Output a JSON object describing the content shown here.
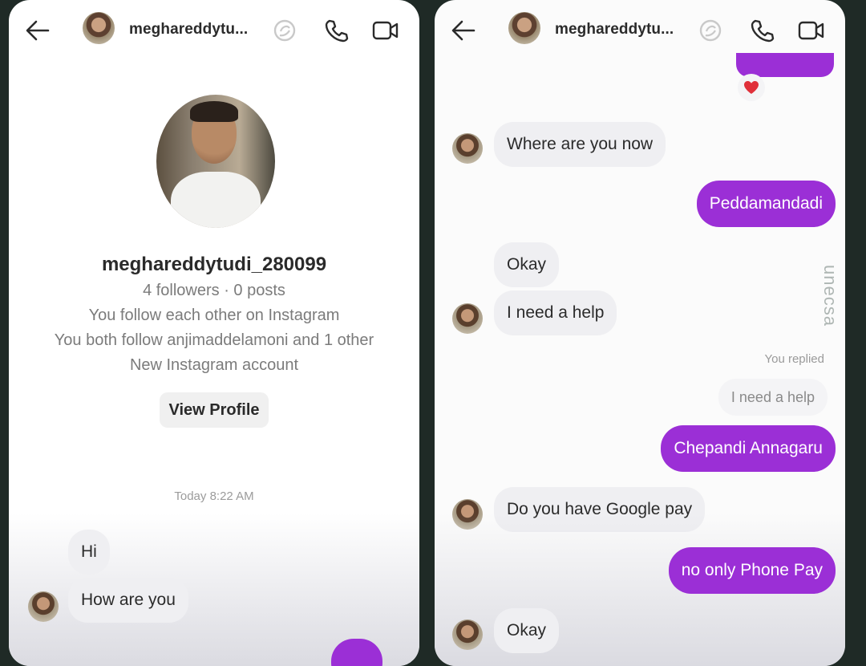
{
  "left": {
    "header": {
      "username": "meghareddytu..."
    },
    "profile": {
      "username": "meghareddytudi_280099",
      "stats": "4 followers · 0 posts",
      "follow_status": "You follow each other on Instagram",
      "mutual": "You both follow anjimaddelamoni and 1 other",
      "account_note": "New Instagram account",
      "view_profile_label": "View Profile"
    },
    "timestamp": "Today 8:22 AM",
    "messages": [
      {
        "from": "them",
        "text": "Hi"
      },
      {
        "from": "them",
        "text": "How are you"
      }
    ]
  },
  "right": {
    "header": {
      "username": "meghareddytu..."
    },
    "reaction": "heart",
    "messages": [
      {
        "from": "them",
        "text": "Where are you now"
      },
      {
        "from": "me",
        "text": "Peddamandadi"
      },
      {
        "from": "them",
        "text": "Okay"
      },
      {
        "from": "them",
        "text": "I need a help"
      },
      {
        "from": "me",
        "text": "Chepandi Annagaru",
        "replied_label": "You replied",
        "replied_to": "I need a help"
      },
      {
        "from": "them",
        "text": "Do you have Google pay"
      },
      {
        "from": "me",
        "text": "no only Phone Pay"
      },
      {
        "from": "them",
        "text": "Okay"
      }
    ]
  },
  "watermark": "unecsa",
  "colors": {
    "outgoing_bubble": "#9b2fd6",
    "incoming_bubble": "#efeff2",
    "heart": "#e0303a"
  }
}
